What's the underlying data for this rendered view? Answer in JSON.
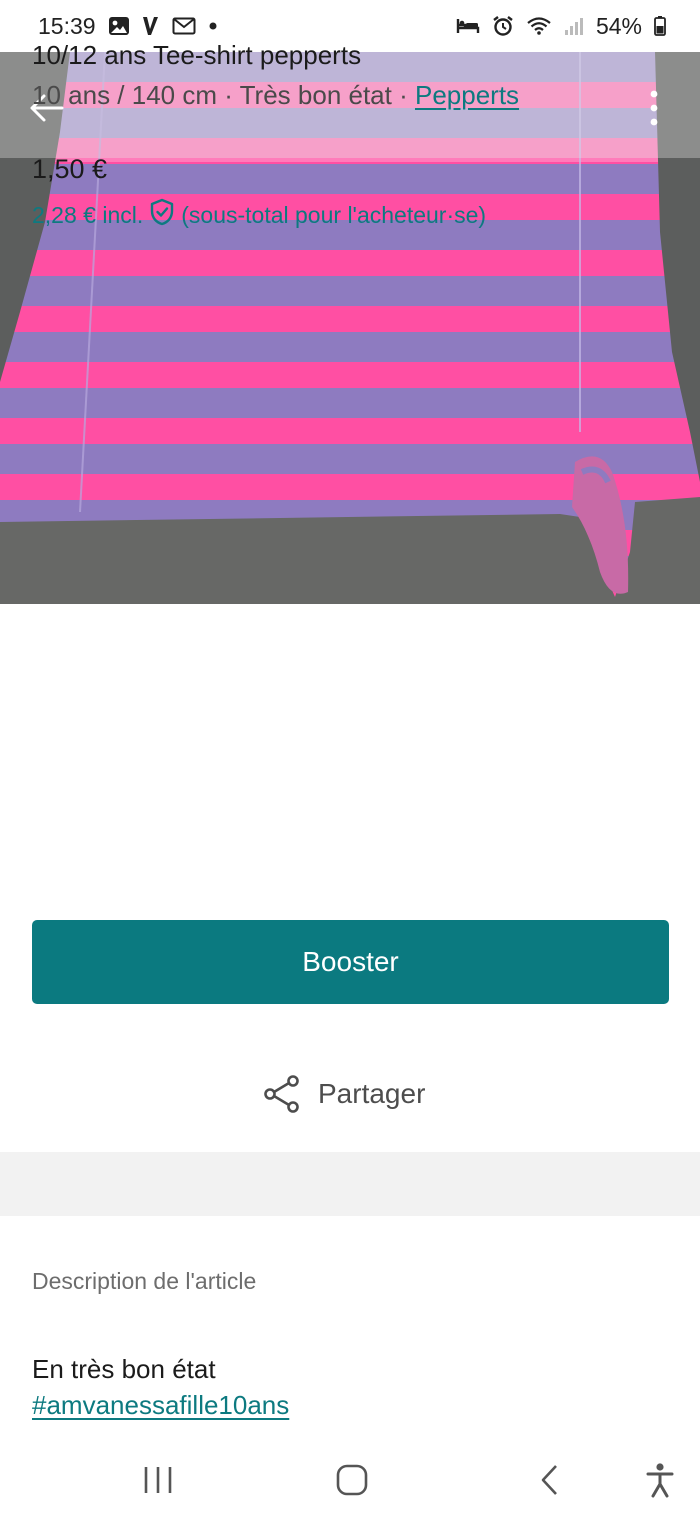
{
  "status_bar": {
    "time": "15:39",
    "battery": "54%",
    "icons": [
      "gallery-icon",
      "v-app-icon",
      "mail-icon",
      "dot-icon",
      "bed-icon",
      "alarm-icon",
      "wifi-icon",
      "signal-icon",
      "battery-icon"
    ]
  },
  "photo": {
    "subject": "striped-tee-shirt",
    "colors": {
      "pink": "#ff4fa3",
      "purple": "#8e7bc0",
      "background": "#5a5b5b"
    }
  },
  "item": {
    "title": "10/12 ans Tee-shirt pepperts",
    "size": "10 ans / 140 cm",
    "separator1": " · ",
    "condition": "Très bon état",
    "separator2": " · ",
    "brand": "Pepperts",
    "price": "1,50 €",
    "price_incl": "2,28 € incl.",
    "price_incl_note": "(sous-total pour l'acheteur·se)"
  },
  "actions": {
    "booster_label": "Booster",
    "share_label": "Partager"
  },
  "description": {
    "heading": "Description de l'article",
    "text": "En très bon état",
    "hashtag": "#amvanessafille10ans"
  },
  "colors": {
    "accent": "#0b7a80",
    "text": "#1b1b1b",
    "muted": "#6d6d6d"
  }
}
